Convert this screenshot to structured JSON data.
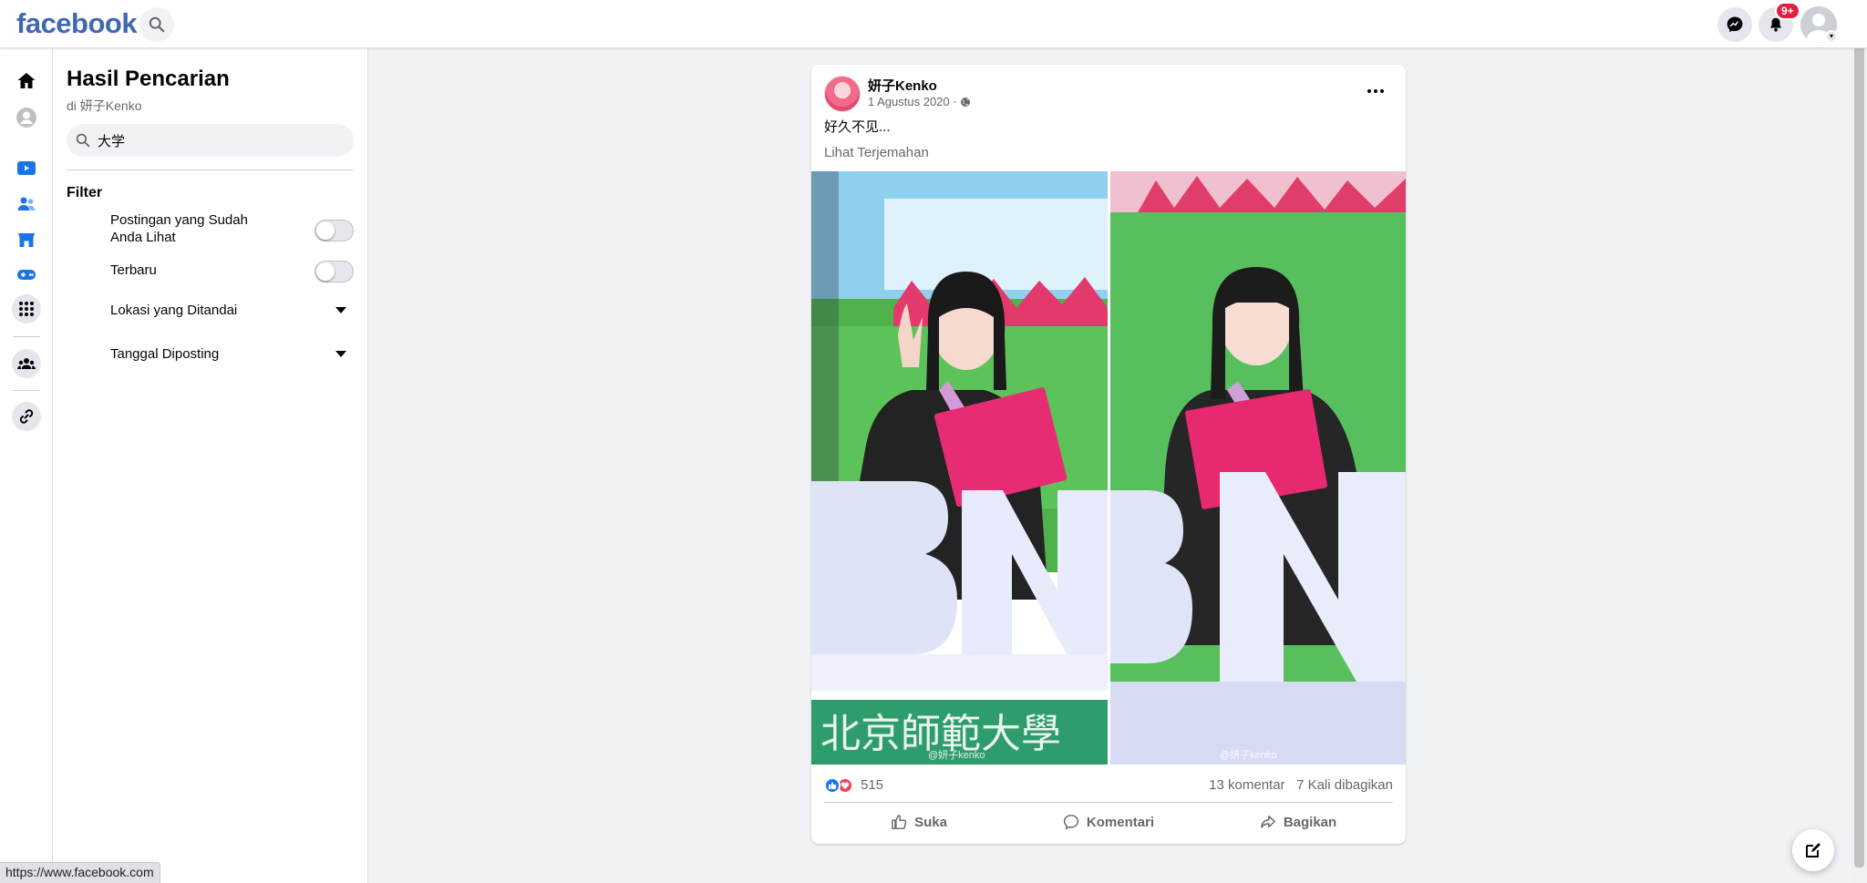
{
  "topbar": {
    "logo": "facebook",
    "notification_badge": "9+"
  },
  "panel": {
    "title": "Hasil Pencarian",
    "subtitle": "di 妍子Kenko",
    "search_value": "大学",
    "filter_title": "Filter",
    "filters": [
      {
        "label": "Postingan yang Sudah Anda Lihat",
        "type": "toggle",
        "on": false
      },
      {
        "label": "Terbaru",
        "type": "toggle",
        "on": false
      },
      {
        "label": "Lokasi yang Ditandai",
        "type": "dropdown"
      },
      {
        "label": "Tanggal Diposting",
        "type": "dropdown"
      }
    ]
  },
  "post": {
    "author": "妍子Kenko",
    "date": "1 Agustus 2020 ·",
    "text": "好久不见...",
    "translate_link": "Lihat Terjemahan",
    "photo_watermark": "@妍子kenko",
    "reaction_count": "515",
    "comments": "13 komentar",
    "shares": "7 Kali dibagikan",
    "actions": {
      "like": "Suka",
      "comment": "Komentari",
      "share": "Bagikan"
    }
  },
  "status_url": "https://www.facebook.com",
  "colors": {
    "brand": "#4267b2",
    "badge": "#e41e3f",
    "like": "#1877f2",
    "love": "#f33e58"
  }
}
